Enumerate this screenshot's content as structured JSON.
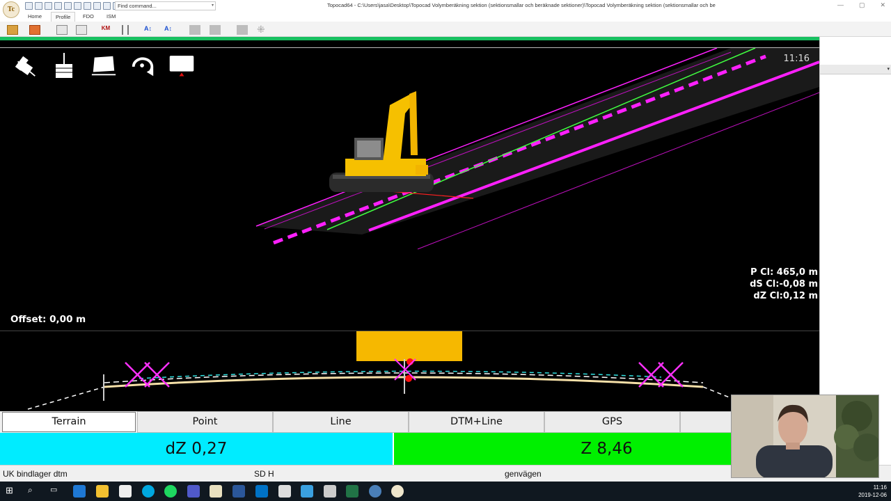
{
  "app": {
    "logo_text": "Tc",
    "title": "Topocad64 - C:\\Users\\jasa\\Desktop\\Topocad Volymberäkning sektion (sektionsmallar och beräknade sektioner)\\Topocad Volymberäkning sektion (sektionsmallar och be",
    "find_command_placeholder": "Find command..."
  },
  "ribbon": {
    "tabs": [
      {
        "label": "Home"
      },
      {
        "label": "Profile"
      },
      {
        "label": "FDO"
      },
      {
        "label": "ISM"
      }
    ],
    "active_tab": "Profile"
  },
  "viewport": {
    "clock": "11:16",
    "offset": "Offset: 0,00 m",
    "readouts": {
      "p_cl": "P Cl: 465,0 m",
      "ds_cl": "dS Cl:-0,08 m",
      "dz_cl": "dZ Cl:0,12 m"
    },
    "tools": [
      {
        "icon": "excavator-icon"
      },
      {
        "icon": "bucket-icon"
      },
      {
        "icon": "surface-icon"
      },
      {
        "icon": "rotate-view-icon"
      },
      {
        "icon": "truck-view-icon"
      }
    ]
  },
  "modes": {
    "buttons": [
      {
        "label": "Terrain"
      },
      {
        "label": "Point"
      },
      {
        "label": "Line"
      },
      {
        "label": "DTM+Line"
      },
      {
        "label": "GPS"
      },
      {
        "label": ""
      }
    ],
    "active": "Terrain"
  },
  "values": {
    "dz": "dZ 0,27",
    "z": "Z 8,46",
    "dz_color": "#00ecff",
    "z_color": "#00f000"
  },
  "status": {
    "layer": "UK bindlager dtm",
    "mode": "SD H",
    "road": "genvägen"
  },
  "taskbar": {
    "time": "11:16",
    "date": "2019-12-06"
  },
  "colors": {
    "magenta": "#ff20ff",
    "green_line": "#40ff40",
    "machine_yellow": "#f6c000"
  }
}
